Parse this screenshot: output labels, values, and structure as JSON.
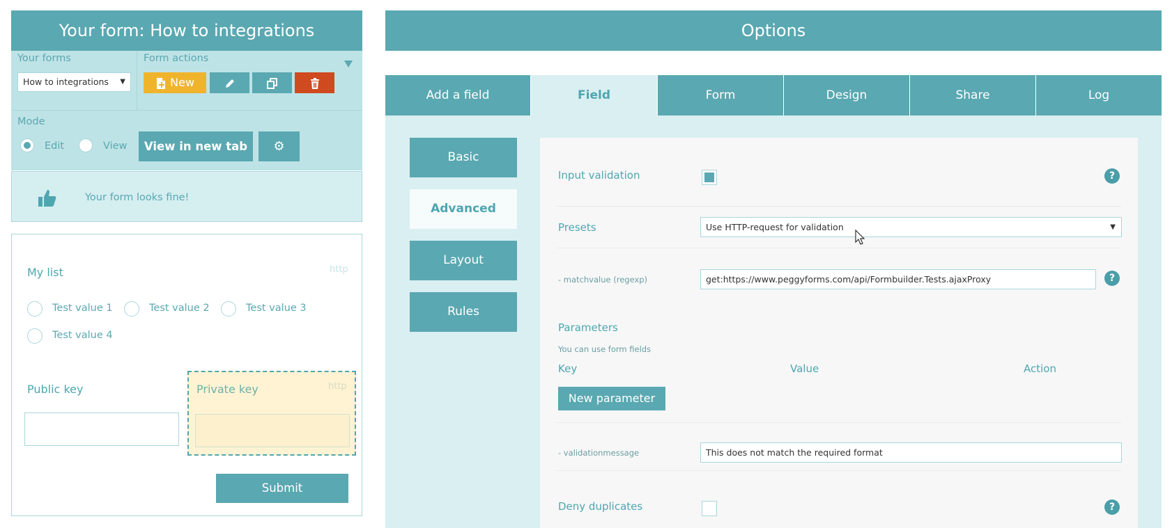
{
  "left": {
    "title": "Your form: How to integrations",
    "your_forms_label": "Your forms",
    "form_actions_label": "Form actions",
    "selected_form": "How to integrations",
    "new_label": "New",
    "mode_label": "Mode",
    "mode_edit": "Edit",
    "mode_view": "View",
    "view_new_tab": "View in new tab",
    "status": "Your form looks fine!"
  },
  "preview": {
    "list_label": "My list",
    "http_tag": "http",
    "options": [
      "Test value 1",
      "Test value 2",
      "Test value 3",
      "Test value 4"
    ],
    "public_key": "Public key",
    "private_key": "Private key",
    "private_http": "http",
    "submit": "Submit"
  },
  "options": {
    "title": "Options",
    "tabs": [
      "Add a field",
      "Field",
      "Form",
      "Design",
      "Share",
      "Log"
    ],
    "active_tab": "Field",
    "side": [
      "Basic",
      "Advanced",
      "Layout",
      "Rules"
    ],
    "active_side": "Advanced",
    "input_validation": "Input validation",
    "presets": "Presets",
    "preset_value": "Use HTTP-request for validation",
    "matchvalue_label": "- matchvalue (regexp)",
    "matchvalue": "get:https://www.peggyforms.com/api/Formbuilder.Tests.ajaxProxy",
    "parameters": "Parameters",
    "parameters_hint": "You can use form fields",
    "col_key": "Key",
    "col_value": "Value",
    "col_action": "Action",
    "new_parameter": "New parameter",
    "validationmessage_label": "- validationmessage",
    "validationmessage": "This does not match the required format",
    "deny_duplicates": "Deny duplicates",
    "help": "?"
  }
}
